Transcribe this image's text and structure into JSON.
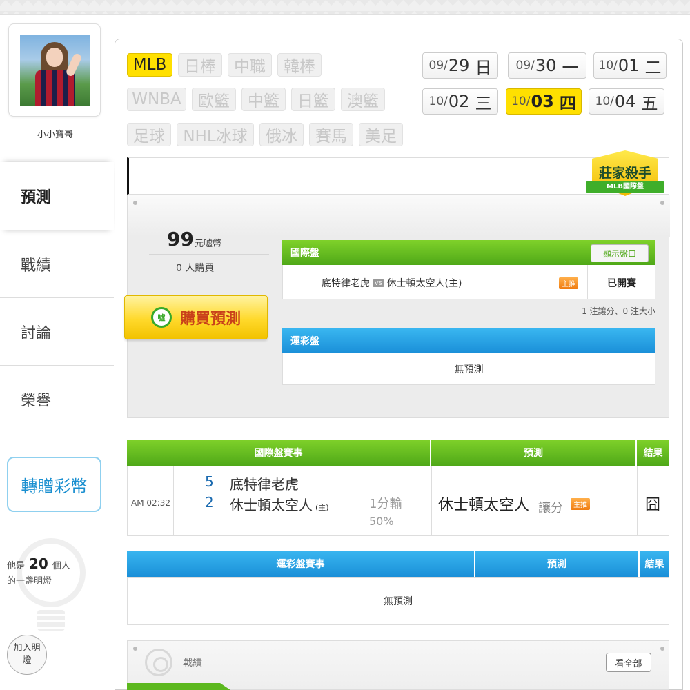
{
  "user": {
    "name": "小小寶哥"
  },
  "nav": [
    {
      "label": "預測",
      "active": true
    },
    {
      "label": "戰績",
      "active": false
    },
    {
      "label": "討論",
      "active": false
    },
    {
      "label": "榮譽",
      "active": false
    }
  ],
  "gift_label": "轉贈彩幣",
  "lamp": {
    "prefix": "他是",
    "count": "20",
    "suffix1": "個人",
    "suffix2": "的一盞明燈",
    "join_label": "加入明燈"
  },
  "leagues": [
    "MLB",
    "日棒",
    "中職",
    "韓棒",
    "WNBA",
    "歐籃",
    "中籃",
    "日籃",
    "澳籃",
    "足球",
    "NHL冰球",
    "俄冰",
    "賽馬",
    "美足"
  ],
  "active_league": "MLB",
  "dates": [
    {
      "m": "09/",
      "d": "29",
      "w": "日",
      "active": false
    },
    {
      "m": "09/",
      "d": "30",
      "w": "一",
      "active": false
    },
    {
      "m": "10/",
      "d": "01",
      "w": "二",
      "active": false
    },
    {
      "m": "10/",
      "d": "02",
      "w": "三",
      "active": false
    },
    {
      "m": "10/",
      "d": "03",
      "w": "四",
      "active": true
    },
    {
      "m": "10/",
      "d": "04",
      "w": "五",
      "active": false
    }
  ],
  "badge": {
    "title": "莊家殺手",
    "ribbon": "MLB國際盤"
  },
  "prediction": {
    "price": "99",
    "price_unit": "元噓幣",
    "buyers": "0 人購買",
    "buy_label": "購買預測",
    "coin_label": "噓",
    "intl": {
      "header": "國際盤",
      "show_label": "顯示盤口",
      "away": "底特律老虎",
      "vs": "VS",
      "home": "休士頓太空人(主)",
      "tag": "主推",
      "status": "已開賽",
      "note": "1 注讓分、0 注大小"
    },
    "lottery": {
      "header": "運彩盤",
      "empty": "無預測"
    }
  },
  "games": {
    "headers": {
      "event": "國際盤賽事",
      "pick": "預測",
      "result": "結果"
    },
    "row": {
      "time": "AM 02:32",
      "score_away": "5",
      "team_away": "底特律老虎",
      "score_home": "2",
      "team_home": "休士頓太空人",
      "home_mark": "(主)",
      "line": "1分輸",
      "pct": "50%",
      "pick_team": "休士頓太空人",
      "pick_type": "讓分",
      "pick_tag": "主推",
      "result": "囧"
    }
  },
  "lottery_games": {
    "headers": {
      "event": "運彩盤賽事",
      "pick": "預測",
      "result": "結果"
    },
    "empty": "無預測"
  },
  "record": {
    "title": "戰績",
    "see_all": "看全部"
  }
}
